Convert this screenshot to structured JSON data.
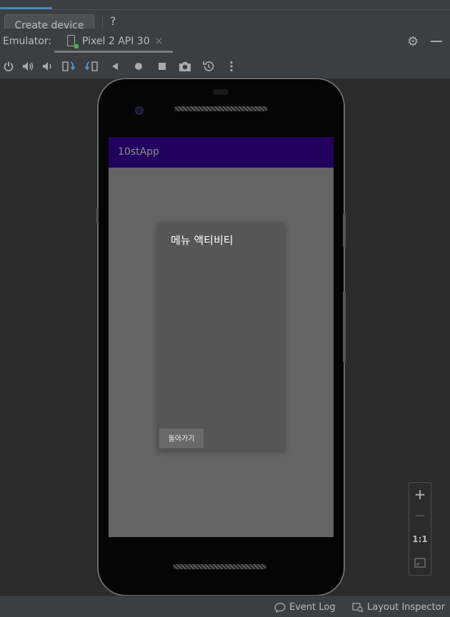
{
  "top": {
    "create_device_label": "Create device",
    "help_label": "?"
  },
  "emulator": {
    "label": "Emulator:",
    "tab_label": "Pixel 2 API 30",
    "tab_close": "×"
  },
  "toolbar": {
    "icons": [
      "power-icon",
      "volume-up-icon",
      "volume-down-icon",
      "rotate-left-icon",
      "rotate-right-icon",
      "back-icon",
      "home-icon",
      "overview-icon",
      "screenshot-icon",
      "snapshot-icon",
      "more-icon"
    ]
  },
  "app": {
    "title": "10stApp",
    "dialog_title": "메뉴 액티비티",
    "back_button_label": "돌아가기",
    "appbar_color": "#22015e"
  },
  "zoom": {
    "plus": "+",
    "minus": "—",
    "one_to_one": "1:1"
  },
  "status": {
    "event_log": "Event Log",
    "layout_inspector": "Layout Inspector"
  }
}
